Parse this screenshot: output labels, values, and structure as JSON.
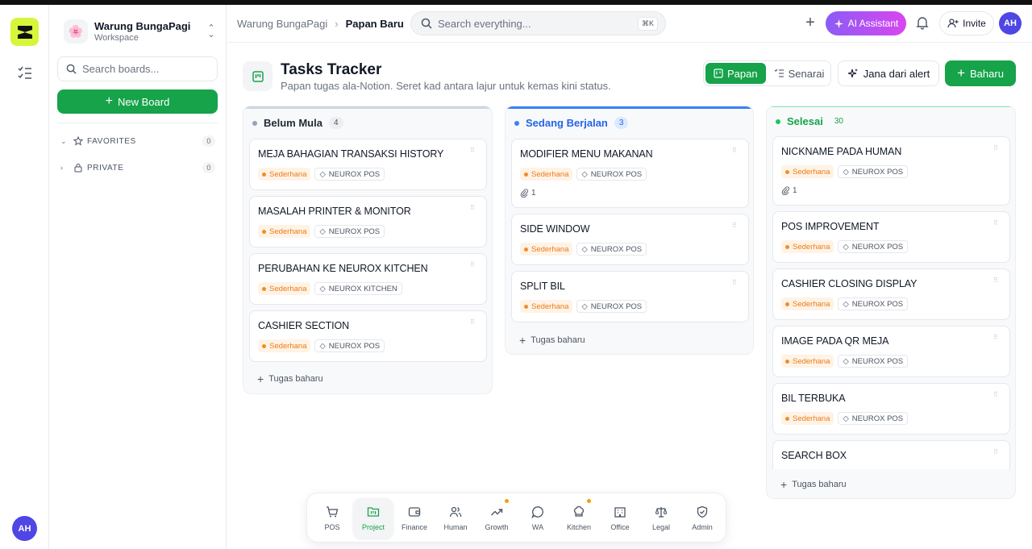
{
  "rail": {
    "avatar_initials": "AH"
  },
  "workspace": {
    "name": "Warung BungaPagi",
    "subtitle": "Workspace",
    "emoji": "🌸"
  },
  "sidebar": {
    "search_placeholder": "Search boards...",
    "new_board_label": "New Board",
    "sections": [
      {
        "label": "FAVORITES",
        "count": "0"
      },
      {
        "label": "PRIVATE",
        "count": "0"
      }
    ]
  },
  "header": {
    "breadcrumb": [
      "Warung BungaPagi",
      "Papan Baru"
    ],
    "search_placeholder": "Search everything...",
    "search_shortcut": "⌘K",
    "ai_label": "AI Assistant",
    "invite_label": "Invite",
    "avatar_initials": "AH"
  },
  "page": {
    "title": "Tasks Tracker",
    "subtitle": "Papan tugas ala-Notion. Seret kad antara lajur untuk kemas kini status.",
    "view_board": "Papan",
    "view_list": "Senarai",
    "generate_label": "Jana dari alert",
    "new_label": "Baharu"
  },
  "colors": {
    "accent": "#16a34a",
    "todo": "#94a3b8",
    "doing": "#3b82f6",
    "done": "#22c55e",
    "priority": "#f28c28"
  },
  "columns": [
    {
      "name": "Belum Mula",
      "count": "4",
      "add_label": "Tugas baharu",
      "cards": [
        {
          "title": "MEJA BAHAGIAN TRANSAKSI HISTORY",
          "priority": "Sederhana",
          "tag": "NEUROX POS"
        },
        {
          "title": "MASALAH PRINTER & MONITOR",
          "priority": "Sederhana",
          "tag": "NEUROX POS"
        },
        {
          "title": "PERUBAHAN KE NEUROX KITCHEN",
          "priority": "Sederhana",
          "tag": "NEUROX KITCHEN"
        },
        {
          "title": "CASHIER SECTION",
          "priority": "Sederhana",
          "tag": "NEUROX POS"
        }
      ]
    },
    {
      "name": "Sedang Berjalan",
      "count": "3",
      "add_label": "Tugas baharu",
      "cards": [
        {
          "title": "MODIFIER MENU MAKANAN",
          "priority": "Sederhana",
          "tag": "NEUROX POS",
          "attachments": "1"
        },
        {
          "title": "SIDE WINDOW",
          "priority": "Sederhana",
          "tag": "NEUROX POS"
        },
        {
          "title": "SPLIT BIL",
          "priority": "Sederhana",
          "tag": "NEUROX POS"
        }
      ]
    },
    {
      "name": "Selesai",
      "count": "30",
      "add_label": "Tugas baharu",
      "cards": [
        {
          "title": "NICKNAME PADA HUMAN",
          "priority": "Sederhana",
          "tag": "NEUROX POS",
          "attachments": "1"
        },
        {
          "title": "POS IMPROVEMENT",
          "priority": "Sederhana",
          "tag": "NEUROX POS"
        },
        {
          "title": "CASHIER CLOSING DISPLAY",
          "priority": "Sederhana",
          "tag": "NEUROX POS"
        },
        {
          "title": "IMAGE PADA QR MEJA",
          "priority": "Sederhana",
          "tag": "NEUROX POS"
        },
        {
          "title": "BIL TERBUKA",
          "priority": "Sederhana",
          "tag": "NEUROX POS"
        },
        {
          "title": "SEARCH BOX"
        }
      ]
    }
  ],
  "dock": [
    {
      "label": "POS",
      "icon": "cart-icon"
    },
    {
      "label": "Project",
      "icon": "folder-kanban-icon",
      "active": true
    },
    {
      "label": "Finance",
      "icon": "wallet-icon"
    },
    {
      "label": "Human",
      "icon": "users-icon"
    },
    {
      "label": "Growth",
      "icon": "trending-up-icon",
      "badge": true
    },
    {
      "label": "WA",
      "icon": "chat-bubble-icon"
    },
    {
      "label": "Kitchen",
      "icon": "chef-hat-icon",
      "badge": true
    },
    {
      "label": "Office",
      "icon": "building-icon"
    },
    {
      "label": "Legal",
      "icon": "scale-icon"
    },
    {
      "label": "Admin",
      "icon": "shield-icon"
    }
  ]
}
